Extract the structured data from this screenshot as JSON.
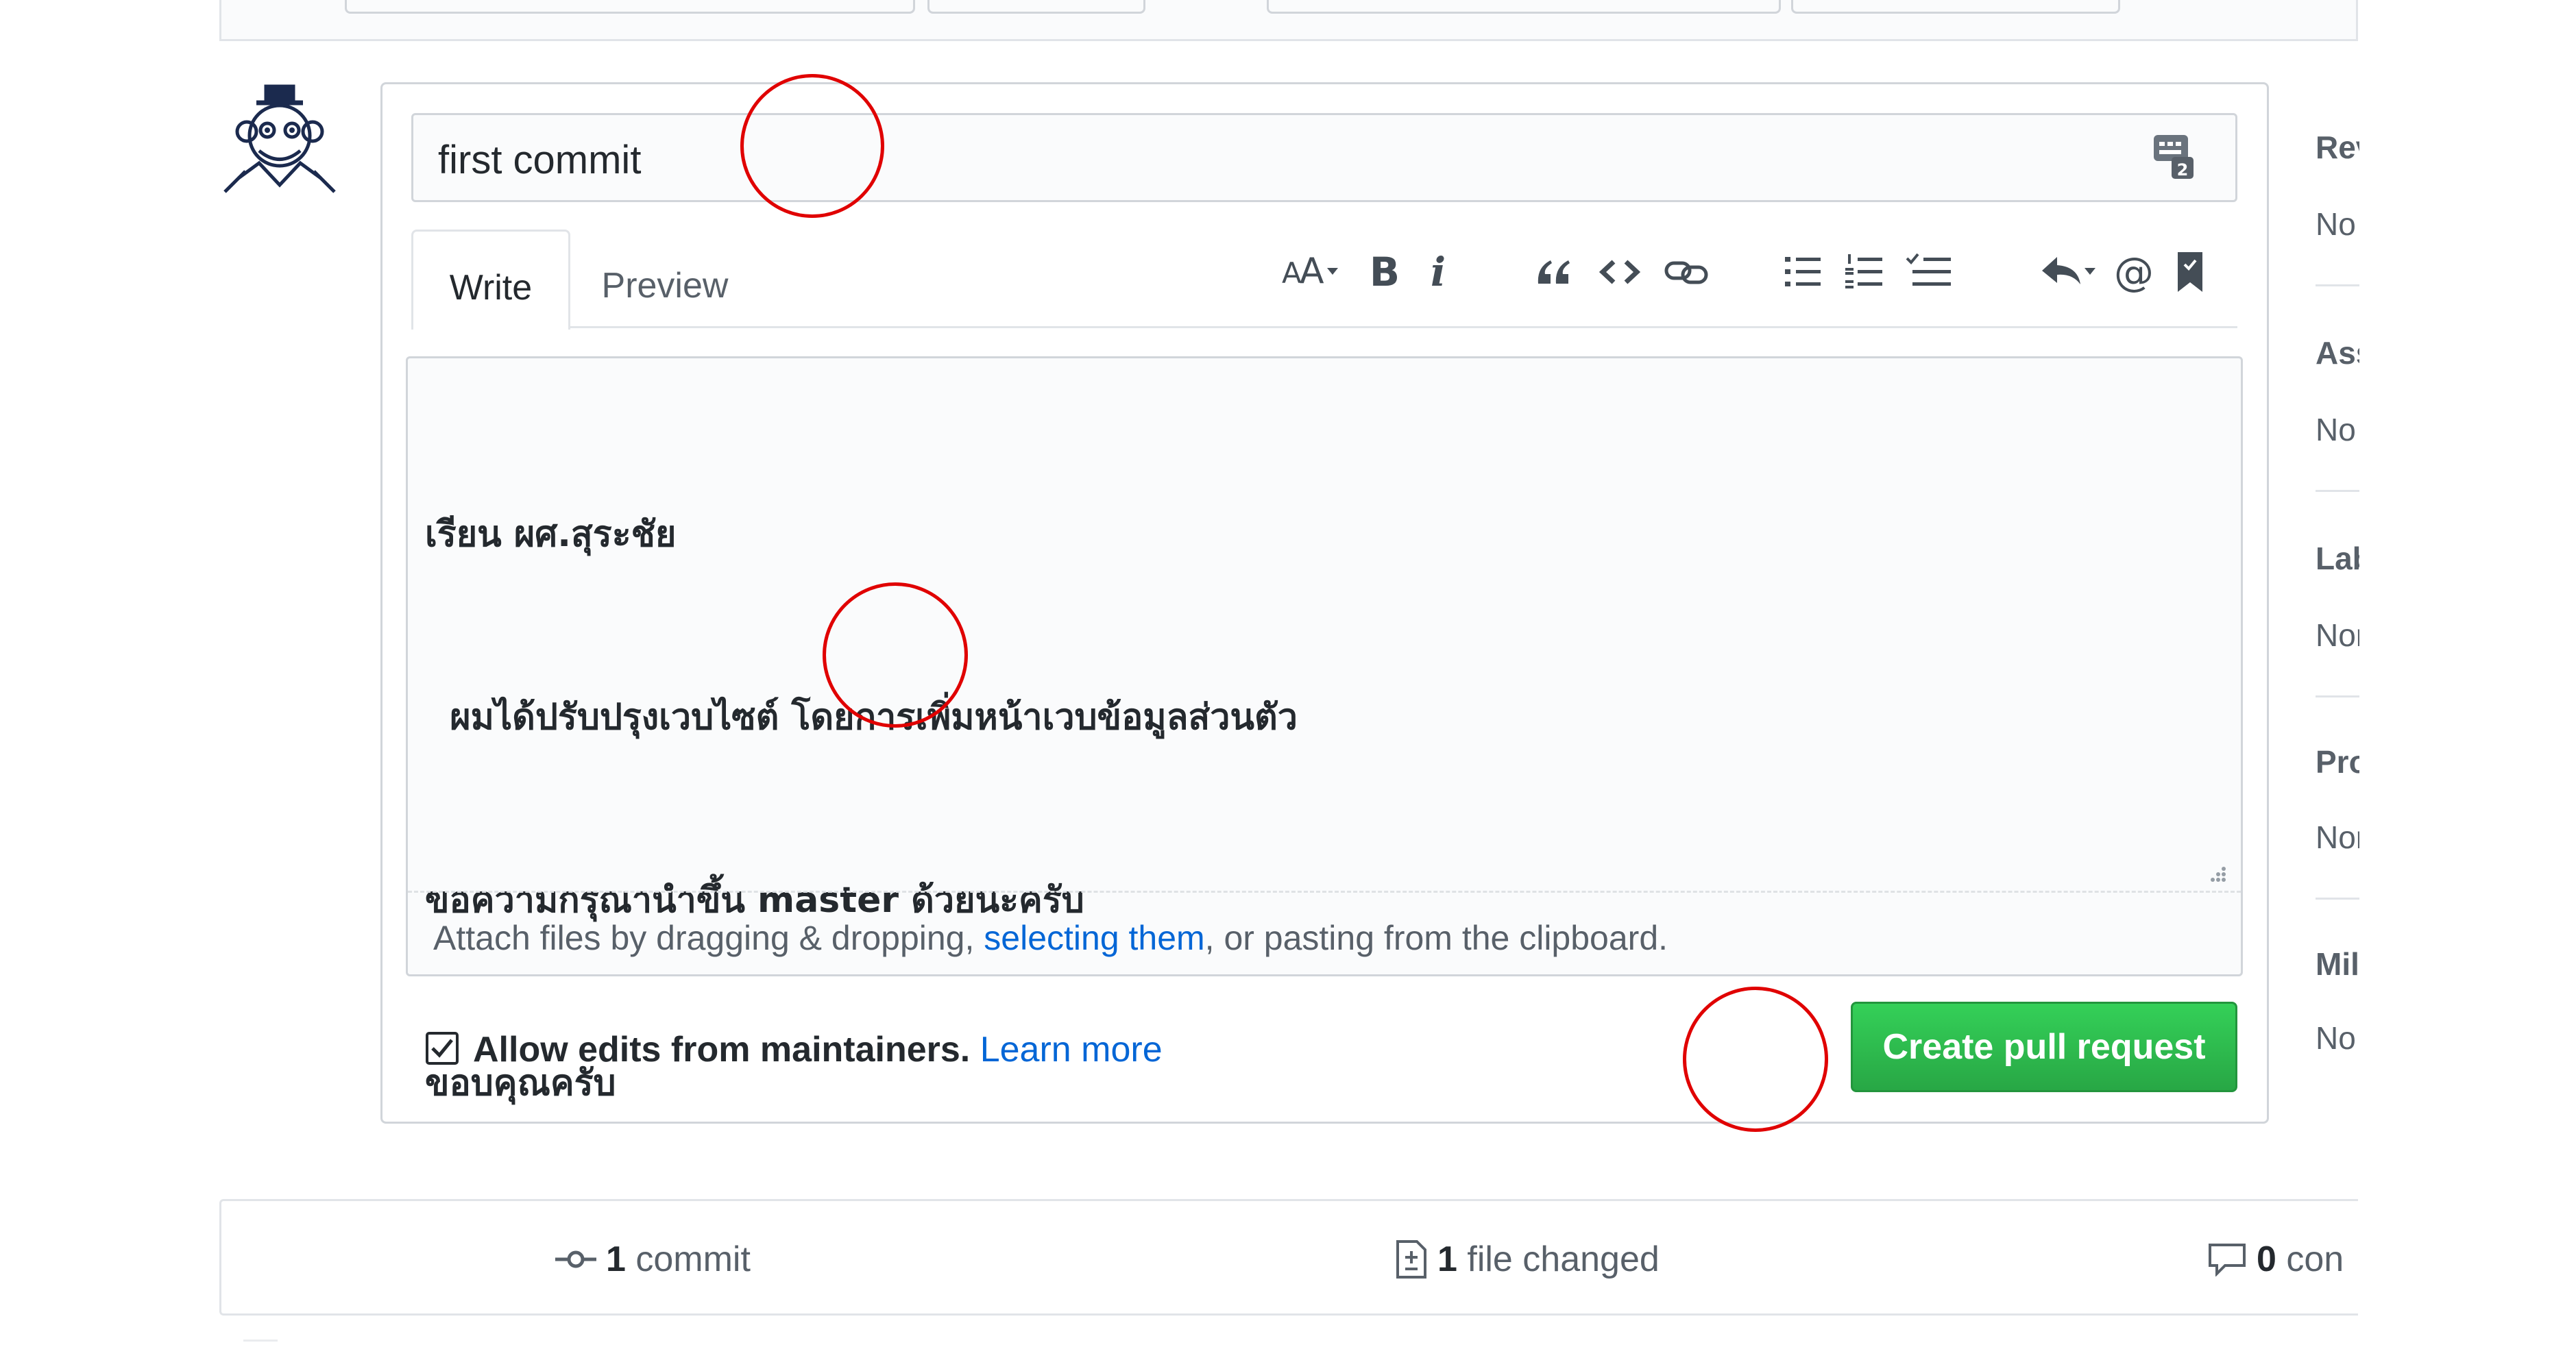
{
  "pr_form": {
    "title_value": "first commit",
    "tabs": [
      {
        "label": "Write",
        "selected": true
      },
      {
        "label": "Preview",
        "selected": false
      }
    ],
    "toolbar": [
      "header-icon",
      "bold-icon",
      "italic-icon",
      "quote-icon",
      "code-icon",
      "link-icon",
      "unordered-list-icon",
      "ordered-list-icon",
      "task-list-icon",
      "reply-icon",
      "mention-icon",
      "bookmark-icon"
    ],
    "toolbar_glyphs": {
      "bold": "B",
      "italic": "i",
      "mention": "@"
    },
    "body_lines": [
      "เรียน ผศ.สุระชัย",
      "  ผมได้ปรับปรุงเวบไซต์ โดยการเพิ่มหน้าเวบข้อมูลส่วนตัว",
      "ขอความกรุณานำขึ้น master ด้วยนะครับ",
      "ขอบคุณครับ"
    ],
    "attach": {
      "prefix": "Attach files by dragging & dropping, ",
      "link": "selecting them",
      "suffix": ", or pasting from the clipboard."
    },
    "allow_edits": {
      "checked": true,
      "label": "Allow edits from maintainers.",
      "learn_more": "Learn more"
    },
    "submit_label": "Create pull request",
    "submit_color": "#2ea44f"
  },
  "sidebar": {
    "sections": [
      {
        "title": "Rev",
        "value": "No"
      },
      {
        "title": "Ass",
        "value": "No"
      },
      {
        "title": "Lab",
        "value": "Nor"
      },
      {
        "title": "Pro",
        "value": "Nor"
      },
      {
        "title": "Mil",
        "value": "No"
      }
    ]
  },
  "summary": {
    "commits_count": "1",
    "commits_label": "commit",
    "files_count": "1",
    "files_label": "file changed",
    "comments_count": "0",
    "comments_label": "con"
  },
  "annotation_color": "#e00000"
}
